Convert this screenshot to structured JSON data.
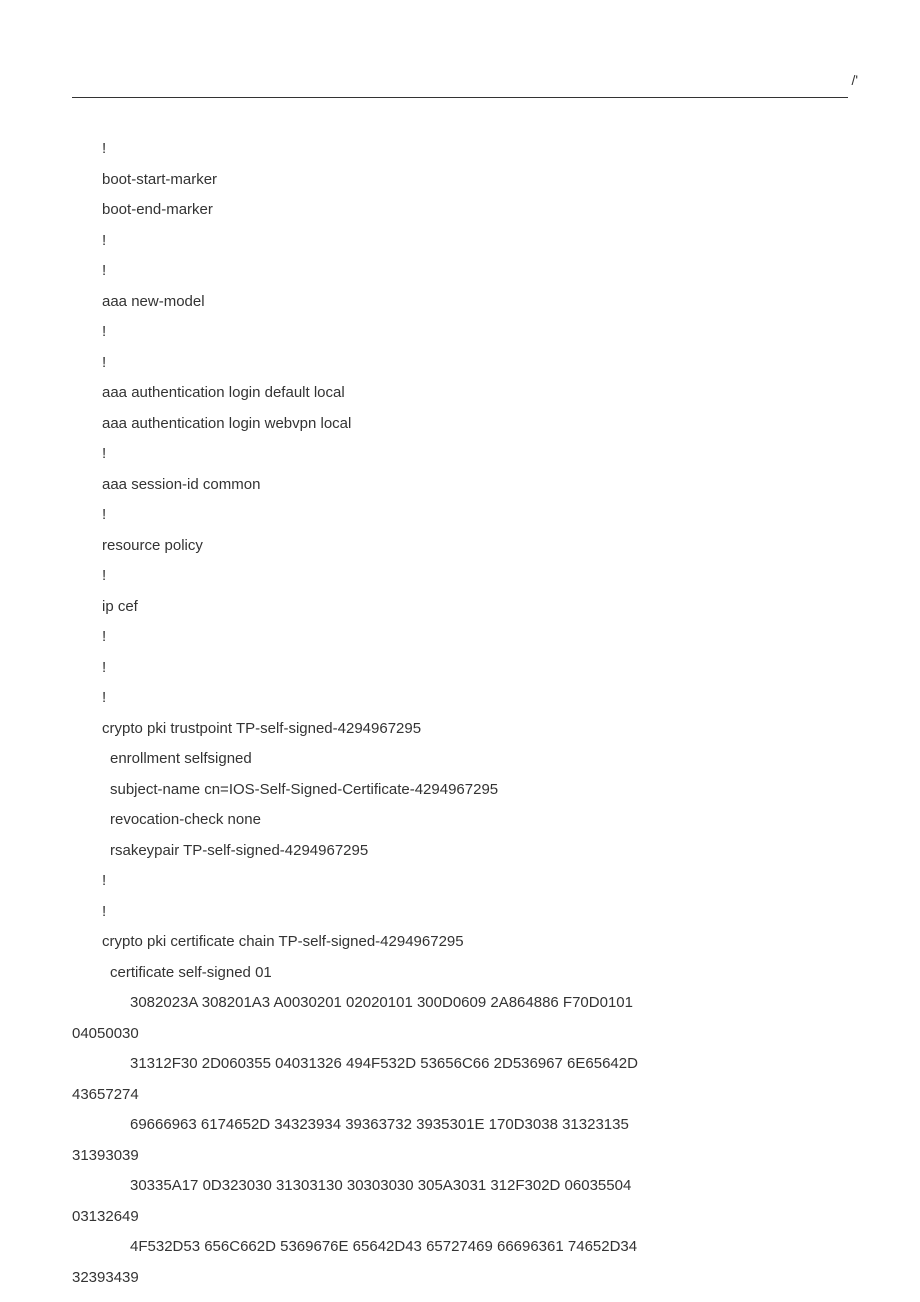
{
  "header": {
    "mark": "/'"
  },
  "lines": [
    {
      "indent": 1,
      "text": "!"
    },
    {
      "indent": 1,
      "text": "boot-start-marker"
    },
    {
      "indent": 1,
      "text": "boot-end-marker"
    },
    {
      "indent": 1,
      "text": "!"
    },
    {
      "indent": 1,
      "text": "!"
    },
    {
      "indent": 1,
      "text": "aaa new-model"
    },
    {
      "indent": 1,
      "text": "!"
    },
    {
      "indent": 1,
      "text": "!"
    },
    {
      "indent": 1,
      "text": "aaa authentication login default local"
    },
    {
      "indent": 1,
      "text": "aaa authentication login webvpn local"
    },
    {
      "indent": 1,
      "text": "!"
    },
    {
      "indent": 1,
      "text": "aaa session-id common"
    },
    {
      "indent": 1,
      "text": "!"
    },
    {
      "indent": 1,
      "text": "resource policy"
    },
    {
      "indent": 1,
      "text": "!"
    },
    {
      "indent": 1,
      "text": "ip cef"
    },
    {
      "indent": 1,
      "text": "!"
    },
    {
      "indent": 1,
      "text": "!"
    },
    {
      "indent": 1,
      "text": "!"
    },
    {
      "indent": 1,
      "text": "crypto pki trustpoint TP-self-signed-4294967295"
    },
    {
      "indent": 2,
      "text": "enrollment selfsigned"
    },
    {
      "indent": 2,
      "text": "subject-name cn=IOS-Self-Signed-Certificate-4294967295"
    },
    {
      "indent": 2,
      "text": "revocation-check none"
    },
    {
      "indent": 2,
      "text": "rsakeypair TP-self-signed-4294967295"
    },
    {
      "indent": 1,
      "text": "!"
    },
    {
      "indent": 1,
      "text": "!"
    },
    {
      "indent": 1,
      "text": "crypto pki certificate chain TP-self-signed-4294967295"
    },
    {
      "indent": 2,
      "text": "certificate self-signed 01"
    },
    {
      "indent": 3,
      "text": "3082023A 308201A3 A0030201 02020101 300D0609 2A864886 F70D0101 "
    },
    {
      "indent": 0,
      "text": "04050030"
    },
    {
      "indent": 3,
      "text": "31312F30 2D060355 04031326 494F532D 53656C66 2D536967 6E65642D "
    },
    {
      "indent": 0,
      "text": "43657274"
    },
    {
      "indent": 3,
      "text": "69666963 6174652D 34323934 39363732 3935301E 170D3038 31323135 "
    },
    {
      "indent": 0,
      "text": "31393039"
    },
    {
      "indent": 3,
      "text": "30335A17 0D323030 31303130 30303030 305A3031 312F302D 06035504 "
    },
    {
      "indent": 0,
      "text": "03132649"
    },
    {
      "indent": 3,
      "text": "4F532D53 656C662D 5369676E 65642D43 65727469 66696361 74652D34 "
    },
    {
      "indent": 0,
      "text": "32393439"
    }
  ]
}
